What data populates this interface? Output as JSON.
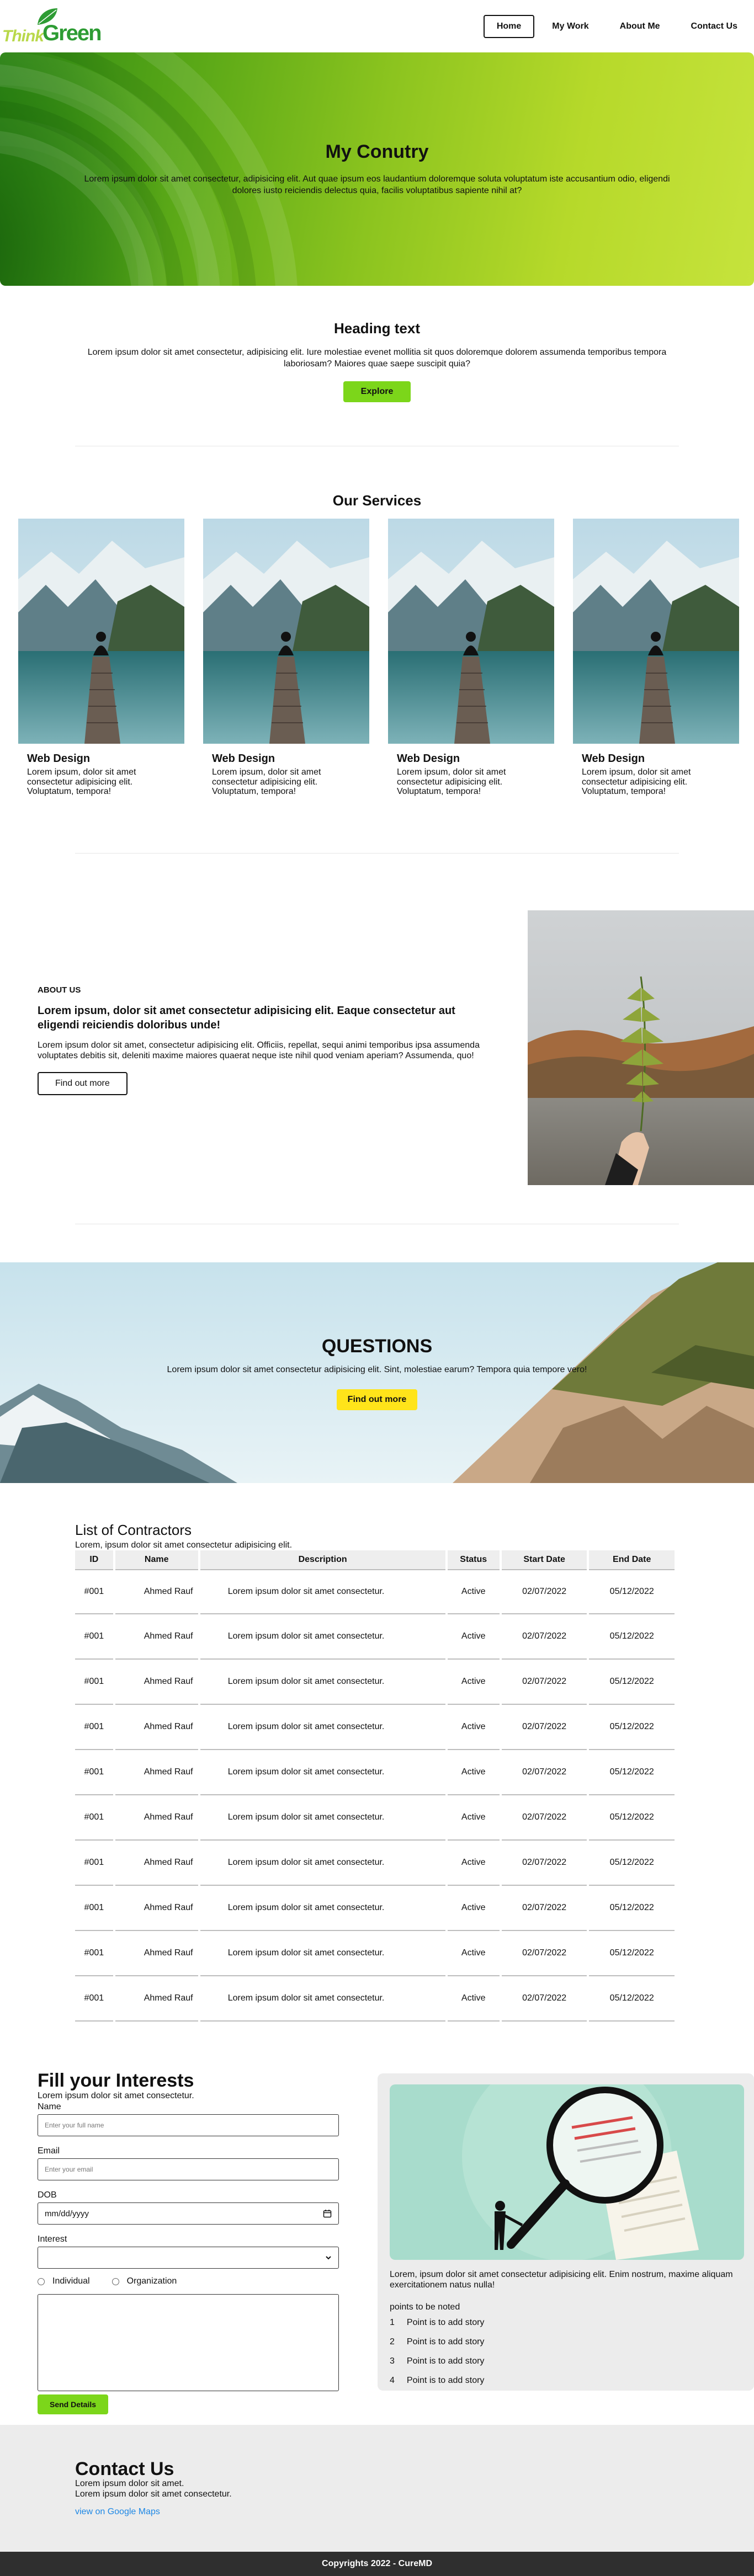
{
  "brand": {
    "think": "Think",
    "green": "Green"
  },
  "nav": {
    "items": [
      "Home",
      "My Work",
      "About Me",
      "Contact Us"
    ],
    "active": "Home"
  },
  "hero": {
    "title": "My Conutry",
    "text": "Lorem ipsum dolor sit amet consectetur, adipisicing elit. Aut quae ipsum eos laudantium doloremque soluta voluptatum iste accusantium odio, eligendi dolores iusto reiciendis delectus quia, facilis voluptatibus sapiente nihil at?"
  },
  "heading": {
    "title": "Heading text",
    "text": "Lorem ipsum dolor sit amet consectetur, adipisicing elit. Iure molestiae evenet mollitia sit quos doloremque dolorem assumenda temporibus tempora laboriosam? Maiores quae saepe suscipit quia?",
    "button": "Explore"
  },
  "services": {
    "title": "Our Services",
    "cards": [
      {
        "title": "Web Design",
        "text": "Lorem ipsum, dolor sit amet consectetur adipisicing elit. Voluptatum, tempora!"
      },
      {
        "title": "Web Design",
        "text": "Lorem ipsum, dolor sit amet consectetur adipisicing elit. Voluptatum, tempora!"
      },
      {
        "title": "Web Design",
        "text": "Lorem ipsum, dolor sit amet consectetur adipisicing elit. Voluptatum, tempora!"
      },
      {
        "title": "Web Design",
        "text": "Lorem ipsum, dolor sit amet consectetur adipisicing elit. Voluptatum, tempora!"
      }
    ]
  },
  "about": {
    "kicker": "ABOUT US",
    "title": "Lorem ipsum, dolor sit amet consectetur adipisicing elit. Eaque consectetur aut eligendi reiciendis doloribus unde!",
    "text": "Lorem ipsum dolor sit amet, consectetur adipisicing elit. Officiis, repellat, sequi animi temporibus ipsa assumenda voluptates debitis sit, deleniti maxime maiores quaerat neque iste nihil quod veniam aperiam? Assumenda, quo!",
    "button": "Find out more"
  },
  "questions": {
    "title": "QUESTIONS",
    "text": "Lorem ipsum dolor sit amet consectetur adipisicing elit. Sint, molestiae earum? Tempora quia tempore vero!",
    "button": "Find out more"
  },
  "contractors": {
    "title": "List of Contractors",
    "subtitle": "Lorem, ipsum dolor sit amet consectetur adipisicing elit.",
    "columns": [
      "ID",
      "Name",
      "Description",
      "Status",
      "Start Date",
      "End Date"
    ],
    "rows": [
      [
        "#001",
        "Ahmed Rauf",
        "Lorem ipsum dolor sit amet consectetur.",
        "Active",
        "02/07/2022",
        "05/12/2022"
      ],
      [
        "#001",
        "Ahmed Rauf",
        "Lorem ipsum dolor sit amet consectetur.",
        "Active",
        "02/07/2022",
        "05/12/2022"
      ],
      [
        "#001",
        "Ahmed Rauf",
        "Lorem ipsum dolor sit amet consectetur.",
        "Active",
        "02/07/2022",
        "05/12/2022"
      ],
      [
        "#001",
        "Ahmed Rauf",
        "Lorem ipsum dolor sit amet consectetur.",
        "Active",
        "02/07/2022",
        "05/12/2022"
      ],
      [
        "#001",
        "Ahmed Rauf",
        "Lorem ipsum dolor sit amet consectetur.",
        "Active",
        "02/07/2022",
        "05/12/2022"
      ],
      [
        "#001",
        "Ahmed Rauf",
        "Lorem ipsum dolor sit amet consectetur.",
        "Active",
        "02/07/2022",
        "05/12/2022"
      ],
      [
        "#001",
        "Ahmed Rauf",
        "Lorem ipsum dolor sit amet consectetur.",
        "Active",
        "02/07/2022",
        "05/12/2022"
      ],
      [
        "#001",
        "Ahmed Rauf",
        "Lorem ipsum dolor sit amet consectetur.",
        "Active",
        "02/07/2022",
        "05/12/2022"
      ],
      [
        "#001",
        "Ahmed Rauf",
        "Lorem ipsum dolor sit amet consectetur.",
        "Active",
        "02/07/2022",
        "05/12/2022"
      ],
      [
        "#001",
        "Ahmed Rauf",
        "Lorem ipsum dolor sit amet consectetur.",
        "Active",
        "02/07/2022",
        "05/12/2022"
      ]
    ]
  },
  "form": {
    "title": "Fill your Interests",
    "subtitle": "Lorem ipsum dolor sit amet consectetur.",
    "name_label": "Name",
    "name_placeholder": "Enter your full name",
    "email_label": "Email",
    "email_placeholder": "Enter your email",
    "dob_label": "DOB",
    "dob_placeholder": "mm/dd/yyyy",
    "interest_label": "Interest",
    "interest_value": "",
    "radio_individual": "Individual",
    "radio_organization": "Organization",
    "submit": "Send Details"
  },
  "side": {
    "text": "Lorem, ipsum dolor sit amet consectetur adipisicing elit. Enim nostrum, maxime aliquam exercitationem natus nulla!",
    "note": "points to be noted",
    "points": [
      {
        "n": "1",
        "text": "Point is to add story"
      },
      {
        "n": "2",
        "text": "Point is to add story"
      },
      {
        "n": "3",
        "text": "Point is to add story"
      },
      {
        "n": "4",
        "text": "Point is to add story"
      }
    ]
  },
  "contact": {
    "title": "Contact Us",
    "line1": "Lorem ipsum dolor sit amet.",
    "line2": "Lorem ipsum dolor sit amet consectetur.",
    "link": "view on Google Maps"
  },
  "footer": {
    "text": "Copyrights 2022 - CureMD"
  },
  "colors": {
    "accent": "#7cd61a",
    "yellow": "#ffe41a",
    "footer": "#2f2f2f"
  }
}
